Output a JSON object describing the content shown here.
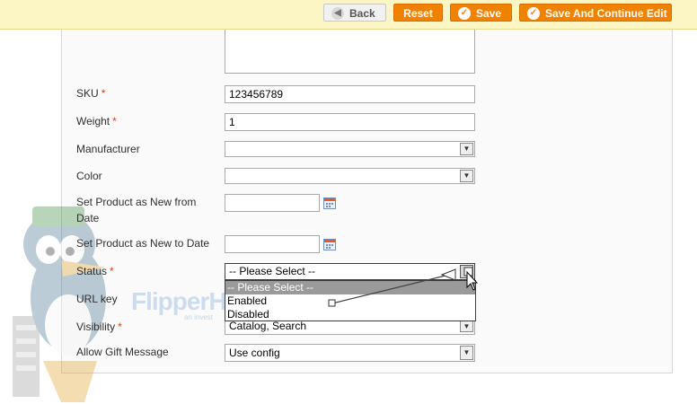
{
  "toolbar": {
    "back_label": "Back",
    "reset_label": "Reset",
    "save_label": "Save",
    "save_continue_label": "Save And Continue Edit"
  },
  "form": {
    "sku": {
      "label": "SKU",
      "required_mark": "*",
      "value": "123456789"
    },
    "weight": {
      "label": "Weight",
      "required_mark": "*",
      "value": "1"
    },
    "manufacturer": {
      "label": "Manufacturer",
      "value": ""
    },
    "color": {
      "label": "Color",
      "value": ""
    },
    "new_from_date": {
      "label_line1": "Set Product as New from",
      "label_line2": "Date",
      "value": ""
    },
    "new_to_date": {
      "label": "Set Product as New to Date",
      "value": ""
    },
    "status": {
      "label": "Status",
      "required_mark": "*",
      "value": "-- Please Select --",
      "options": [
        "-- Please Select --",
        "Enabled",
        "Disabled"
      ]
    },
    "url_key": {
      "label": "URL key"
    },
    "visibility": {
      "label": "Visibility",
      "required_mark": "*",
      "value": "Catalog, Search"
    },
    "gift_message": {
      "label": "Allow Gift Message",
      "value": "Use config"
    }
  },
  "watermark": {
    "brand": "FlipperH",
    "tagline": "an invest"
  },
  "colors": {
    "toolbar_bg": "#fbf6c4",
    "button_orange": "#f18200",
    "required_red": "#eb340a"
  }
}
